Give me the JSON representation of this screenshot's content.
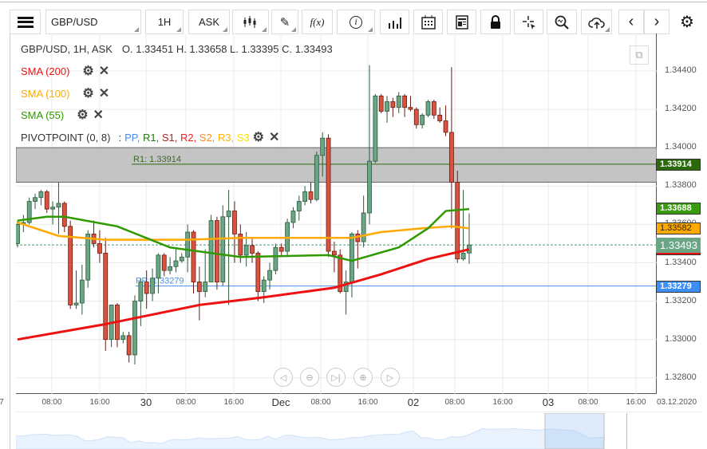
{
  "toolbar": {
    "menu_icon": "hamburger-icon",
    "symbol": "GBP/USD",
    "interval": "1H",
    "price_type": "ASK",
    "chart_type_icon": "candlestick-icon",
    "draw_icon": "pencil-icon",
    "indicator_label": "f(x)",
    "info_icon": "info-icon",
    "volume_icon": "bar-chart-icon",
    "calendar_icon": "calendar-icon",
    "news_icon": "news-icon",
    "lock_icon": "lock-icon",
    "crosshair_icon": "crosshair-icon",
    "zoom_icon": "zoom-chart-icon",
    "cloud_icon": "cloud-upload-icon",
    "prev_icon": "chevron-left-icon",
    "next_icon": "chevron-right-icon",
    "settings_icon": "gear-icon"
  },
  "legend": {
    "header": "GBP/USD, 1H, ASK",
    "ohlc": "O. 1.33451 H. 1.33658 L. 1.33395 C. 1.33493",
    "sma200": "SMA (200)",
    "sma100": "SMA (100)",
    "sma55": "SMA (55)",
    "pivot": "PIVOTPOINT (0, 8)",
    "pivot_sep": ":",
    "pivot_items": [
      {
        "t": "PP",
        "c": "#3d8ef5"
      },
      {
        "t": "R1",
        "c": "#2a7a1a"
      },
      {
        "t": "S1",
        "c": "#b22222"
      },
      {
        "t": "R2",
        "c": "#ff1a1a"
      },
      {
        "t": "S2",
        "c": "#ff8c1a"
      },
      {
        "t": "R3",
        "c": "#ffb400"
      },
      {
        "t": "S3",
        "c": "#ffe000"
      }
    ]
  },
  "colors": {
    "up": "#6aa585",
    "down": "#d9533f",
    "sma200": "#ee1111",
    "sma100": "#ffaa00",
    "sma55": "#2e9900",
    "pp": "#4a8ff0",
    "r1": "#2a6a0a",
    "zone": "#c4c4c4"
  },
  "price_axis": [
    "1.34400",
    "1.34200",
    "1.34000",
    "1.33800",
    "1.33600",
    "1.33400",
    "1.33200",
    "1.33000",
    "1.32800"
  ],
  "time_axis": [
    {
      "t": "7",
      "big": false
    },
    {
      "t": "08:00"
    },
    {
      "t": "16:00"
    },
    {
      "t": "30",
      "big": true
    },
    {
      "t": "08:00"
    },
    {
      "t": "16:00"
    },
    {
      "t": "Dec",
      "big": true
    },
    {
      "t": "08:00"
    },
    {
      "t": "16:00"
    },
    {
      "t": "02",
      "big": true
    },
    {
      "t": "08:00"
    },
    {
      "t": "16:00"
    },
    {
      "t": "03",
      "big": true
    },
    {
      "t": "08:00"
    },
    {
      "t": "16:00"
    },
    {
      "t": "03.12.2020"
    }
  ],
  "markers": {
    "r1": "1.33914",
    "sma55": "1.33688",
    "sma100": "1.33582",
    "last": "1.33493",
    "pp": "1.33279"
  },
  "lines": {
    "r1_label": "R1: 1.33914",
    "pp_label": "PP: 1.33279",
    "r1": 1.33914,
    "pp": 1.33279,
    "last": 1.33493,
    "zone": [
      1.3382,
      1.34
    ]
  },
  "zoom_controls": [
    "scroll-left-icon",
    "zoom-out-icon",
    "scroll-end-icon",
    "zoom-in-icon",
    "scroll-right-icon"
  ],
  "chart_data": {
    "type": "candlestick",
    "ylim": [
      1.3272,
      1.3452
    ],
    "grid": true,
    "candles": [
      [
        1.335,
        1.3362,
        1.3348,
        1.336
      ],
      [
        1.336,
        1.3365,
        1.3356,
        1.3361
      ],
      [
        1.3361,
        1.3374,
        1.336,
        1.3372
      ],
      [
        1.3372,
        1.3376,
        1.3368,
        1.3374
      ],
      [
        1.3374,
        1.3378,
        1.337,
        1.3377
      ],
      [
        1.3377,
        1.3378,
        1.3366,
        1.3368
      ],
      [
        1.3368,
        1.3372,
        1.336,
        1.3369
      ],
      [
        1.3369,
        1.3382,
        1.3355,
        1.3371
      ],
      [
        1.3371,
        1.3372,
        1.3356,
        1.3359
      ],
      [
        1.3359,
        1.3362,
        1.3316,
        1.3318
      ],
      [
        1.3318,
        1.3336,
        1.3316,
        1.3319
      ],
      [
        1.3319,
        1.3339,
        1.3313,
        1.3331
      ],
      [
        1.3331,
        1.3357,
        1.3327,
        1.3355
      ],
      [
        1.3355,
        1.3362,
        1.3348,
        1.335
      ],
      [
        1.335,
        1.3357,
        1.334,
        1.3345
      ],
      [
        1.3345,
        1.3353,
        1.3294,
        1.33
      ],
      [
        1.33,
        1.3318,
        1.3296,
        1.3318
      ],
      [
        1.3318,
        1.3319,
        1.3296,
        1.33
      ],
      [
        1.33,
        1.3304,
        1.3298,
        1.3302
      ],
      [
        1.3302,
        1.3304,
        1.3288,
        1.3292
      ],
      [
        1.3292,
        1.3323,
        1.3287,
        1.332
      ],
      [
        1.332,
        1.3332,
        1.3307,
        1.333
      ],
      [
        1.333,
        1.3336,
        1.3316,
        1.3324
      ],
      [
        1.3324,
        1.3337,
        1.332,
        1.3332
      ],
      [
        1.3332,
        1.3345,
        1.3324,
        1.3344
      ],
      [
        1.3344,
        1.3345,
        1.3333,
        1.3336
      ],
      [
        1.3336,
        1.3343,
        1.3334,
        1.3338
      ],
      [
        1.3338,
        1.3347,
        1.3335,
        1.3341
      ],
      [
        1.3341,
        1.3345,
        1.334,
        1.3343
      ],
      [
        1.3343,
        1.336,
        1.3335,
        1.3356
      ],
      [
        1.3356,
        1.3357,
        1.3324,
        1.333
      ],
      [
        1.333,
        1.3338,
        1.331,
        1.3325
      ],
      [
        1.3325,
        1.3347,
        1.3322,
        1.333
      ],
      [
        1.333,
        1.3365,
        1.333,
        1.3362
      ],
      [
        1.3362,
        1.3364,
        1.3326,
        1.333
      ],
      [
        1.333,
        1.337,
        1.3328,
        1.3364
      ],
      [
        1.3364,
        1.3378,
        1.3318,
        1.3367
      ],
      [
        1.3367,
        1.3372,
        1.334,
        1.3355
      ],
      [
        1.3355,
        1.336,
        1.334,
        1.3344
      ],
      [
        1.3344,
        1.3356,
        1.3338,
        1.3349
      ],
      [
        1.3349,
        1.3353,
        1.334,
        1.3345
      ],
      [
        1.3345,
        1.3346,
        1.332,
        1.3325
      ],
      [
        1.3325,
        1.3333,
        1.3319,
        1.3331
      ],
      [
        1.3331,
        1.334,
        1.3326,
        1.3336
      ],
      [
        1.3336,
        1.335,
        1.3334,
        1.3348
      ],
      [
        1.3348,
        1.335,
        1.3344,
        1.3346
      ],
      [
        1.3346,
        1.3363,
        1.3343,
        1.3361
      ],
      [
        1.3361,
        1.3369,
        1.3358,
        1.3367
      ],
      [
        1.3367,
        1.3375,
        1.3362,
        1.3372
      ],
      [
        1.3372,
        1.338,
        1.337,
        1.3377
      ],
      [
        1.3377,
        1.3382,
        1.3371,
        1.3373
      ],
      [
        1.3373,
        1.3398,
        1.3372,
        1.3396
      ],
      [
        1.3396,
        1.3408,
        1.3385,
        1.3405
      ],
      [
        1.3405,
        1.3407,
        1.3343,
        1.3346
      ],
      [
        1.3346,
        1.3351,
        1.3335,
        1.3344
      ],
      [
        1.3344,
        1.3347,
        1.3324,
        1.3325
      ],
      [
        1.3325,
        1.3336,
        1.3313,
        1.333
      ],
      [
        1.333,
        1.3356,
        1.3322,
        1.3355
      ],
      [
        1.3355,
        1.3357,
        1.3337,
        1.3351
      ],
      [
        1.3351,
        1.3375,
        1.3348,
        1.3366
      ],
      [
        1.3366,
        1.3443,
        1.336,
        1.3393
      ],
      [
        1.3393,
        1.3428,
        1.3392,
        1.3427
      ],
      [
        1.3427,
        1.3428,
        1.3418,
        1.3419
      ],
      [
        1.3419,
        1.3427,
        1.3413,
        1.3424
      ],
      [
        1.3424,
        1.3426,
        1.3416,
        1.3421
      ],
      [
        1.3421,
        1.3429,
        1.3418,
        1.3427
      ],
      [
        1.3427,
        1.3428,
        1.3416,
        1.3421
      ],
      [
        1.3421,
        1.3427,
        1.3419,
        1.342
      ],
      [
        1.342,
        1.3421,
        1.341,
        1.3412
      ],
      [
        1.3412,
        1.3418,
        1.341,
        1.3417
      ],
      [
        1.3417,
        1.3425,
        1.3416,
        1.3424
      ],
      [
        1.3424,
        1.3425,
        1.3415,
        1.3417
      ],
      [
        1.3417,
        1.3421,
        1.3413,
        1.3414
      ],
      [
        1.3414,
        1.3422,
        1.3406,
        1.3408
      ],
      [
        1.3408,
        1.3442,
        1.3358,
        1.3382
      ],
      [
        1.3382,
        1.3388,
        1.334,
        1.3342
      ],
      [
        1.3342,
        1.3378,
        1.3341,
        1.3345
      ],
      [
        1.33451,
        1.33658,
        1.33395,
        1.33493
      ]
    ],
    "sma200": [
      [
        0,
        1.33
      ],
      [
        15,
        1.3308
      ],
      [
        31,
        1.3318
      ],
      [
        42,
        1.3322
      ],
      [
        54,
        1.3327
      ],
      [
        62,
        1.3334
      ],
      [
        70,
        1.3342
      ],
      [
        77,
        1.3347
      ]
    ],
    "sma100": [
      [
        0,
        1.3361
      ],
      [
        7,
        1.3354
      ],
      [
        15,
        1.3352
      ],
      [
        29,
        1.3352
      ],
      [
        38,
        1.3353
      ],
      [
        52,
        1.3353
      ],
      [
        57,
        1.3353
      ],
      [
        62,
        1.3356
      ],
      [
        69,
        1.3358
      ],
      [
        74,
        1.3359
      ],
      [
        77,
        1.3358
      ]
    ],
    "sma55": [
      [
        0,
        1.3362
      ],
      [
        5,
        1.3364
      ],
      [
        8,
        1.3364
      ],
      [
        17,
        1.3359
      ],
      [
        26,
        1.3348
      ],
      [
        38,
        1.3343
      ],
      [
        53,
        1.3344
      ],
      [
        57,
        1.3341
      ],
      [
        65,
        1.3348
      ],
      [
        70,
        1.3358
      ],
      [
        73,
        1.3367
      ],
      [
        77,
        1.3368
      ]
    ]
  }
}
